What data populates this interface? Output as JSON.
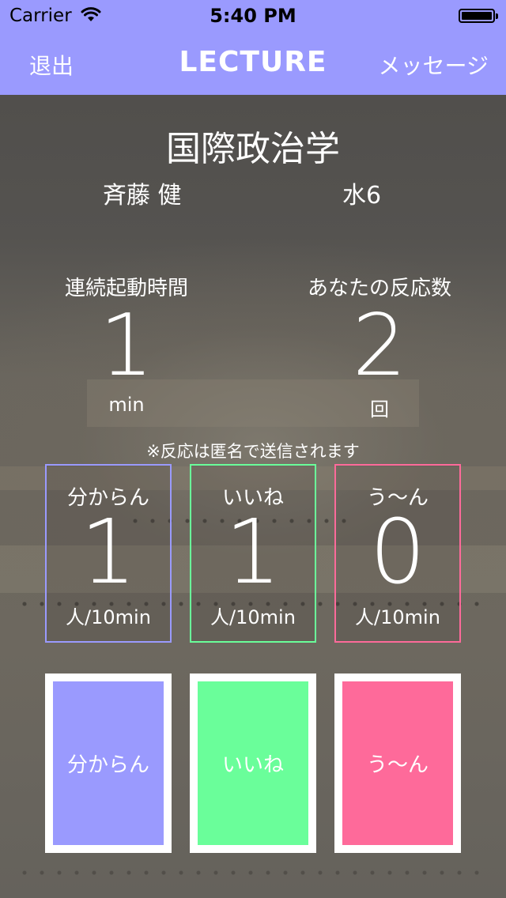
{
  "status_bar": {
    "carrier": "Carrier",
    "time": "5:40 PM",
    "icons": [
      "wifi-icon",
      "battery-icon"
    ]
  },
  "nav": {
    "left_label": "退出",
    "title": "LECTURE",
    "right_label": "メッセージ"
  },
  "course": {
    "title": "国際政治学",
    "teacher": "斉藤 健",
    "period": "水6"
  },
  "stats": {
    "uptime": {
      "label": "連続起動時間",
      "value": "1",
      "unit": "min"
    },
    "reactions": {
      "label": "あなたの反応数",
      "value": "2",
      "unit": "回"
    }
  },
  "note": "※反応は匿名で送信されます",
  "counters": [
    {
      "label": "分からん",
      "value": "1",
      "unit": "人/10min"
    },
    {
      "label": "いいね",
      "value": "1",
      "unit": "人/10min"
    },
    {
      "label": "う〜ん",
      "value": "0",
      "unit": "人/10min"
    }
  ],
  "buttons": [
    {
      "label": "分からん"
    },
    {
      "label": "いいね"
    },
    {
      "label": "う〜ん"
    }
  ],
  "colors": {
    "accent": "#9a9afe",
    "wakaran": "#9a9afe",
    "iine": "#6afe9a",
    "uun": "#fe6a9a"
  }
}
